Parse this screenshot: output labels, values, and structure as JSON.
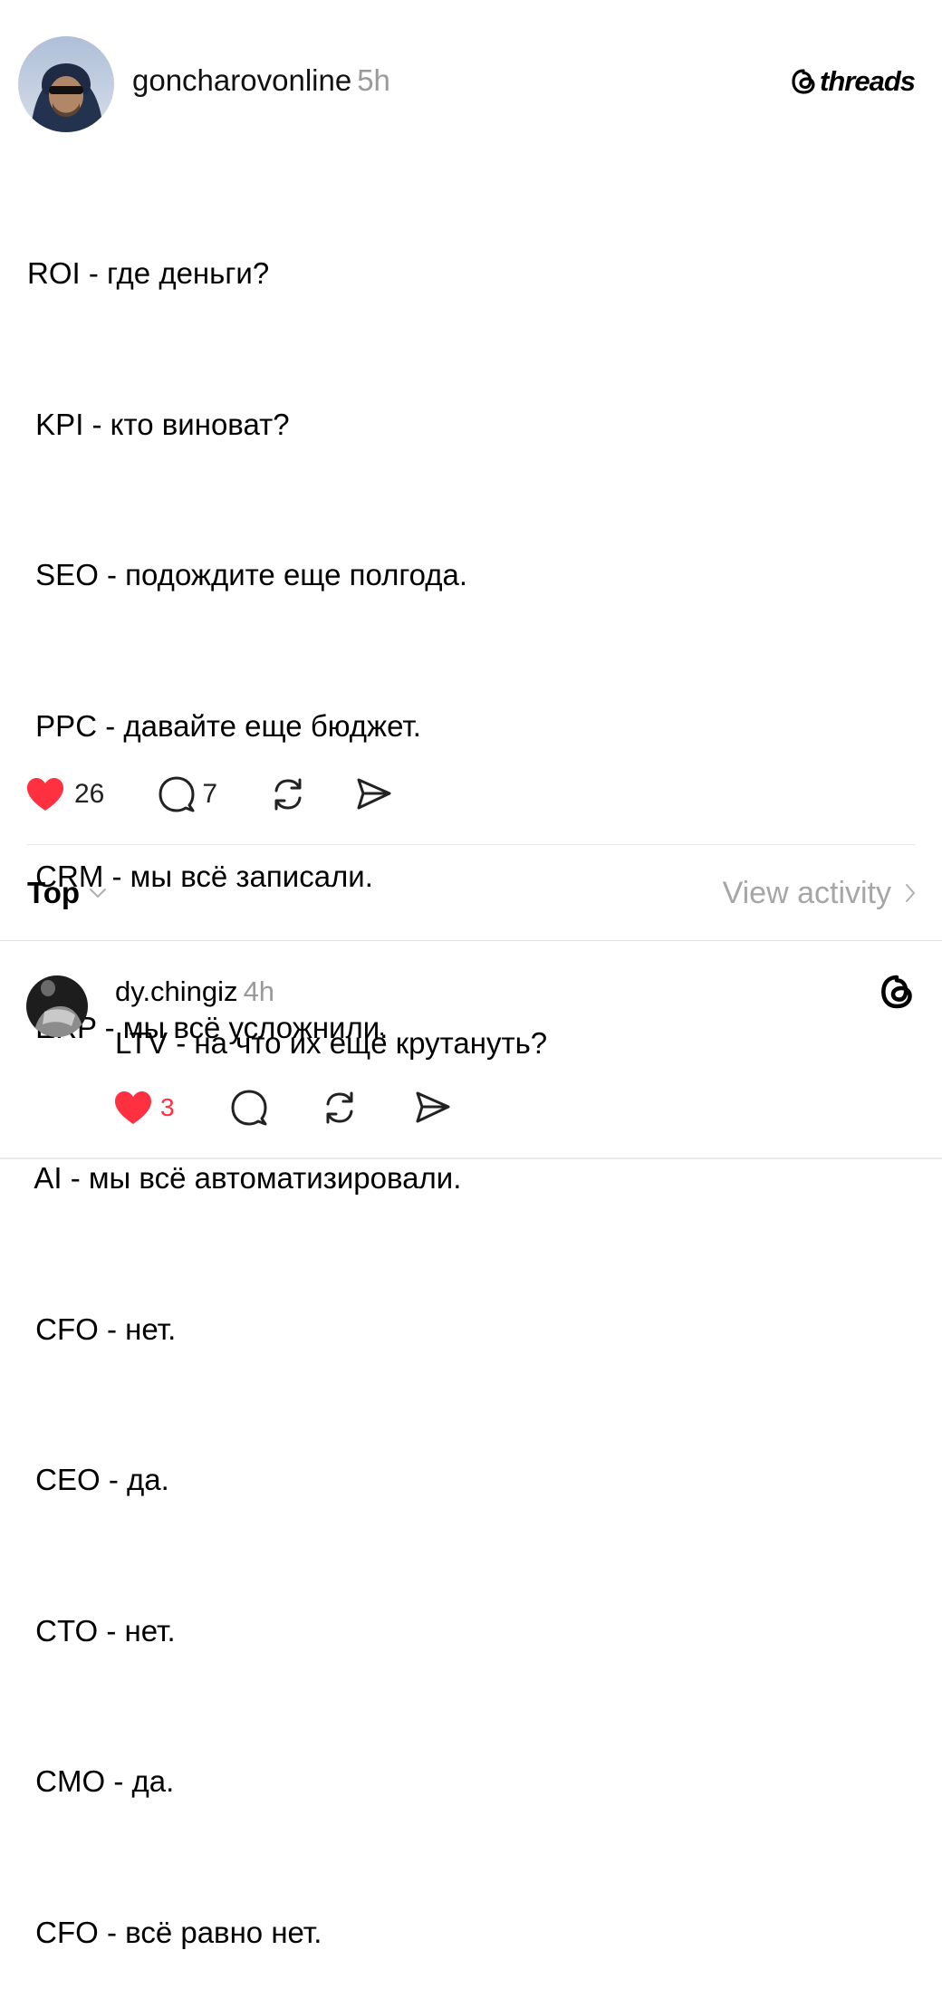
{
  "post": {
    "author": {
      "username": "goncharovonline",
      "time": "5h"
    },
    "brand": {
      "name": "threads",
      "icon": "threads-icon"
    },
    "lines": [
      "ROI - где деньги?",
      " KPI - кто виноват?",
      " SEO - подождите еще полгода.",
      " PPC - давайте еще бюджет.",
      " CRM - мы всё записали.",
      " ERP - мы всё усложнили.",
      " AI - мы всё автоматизировали.",
      " CFO - нет.",
      " CEO - да.",
      " CTO - нет.",
      " CMO - да.",
      " CFO - всё равно нет."
    ],
    "actions": {
      "likes": "26",
      "comments": "7",
      "like_color": "#ff3040"
    }
  },
  "replies_bar": {
    "sort_label": "Top",
    "activity_label": "View activity"
  },
  "reply": {
    "username": "dy.chingiz",
    "time": "4h",
    "text": "LTV - на что их ещё крутануть?",
    "likes": "3"
  }
}
